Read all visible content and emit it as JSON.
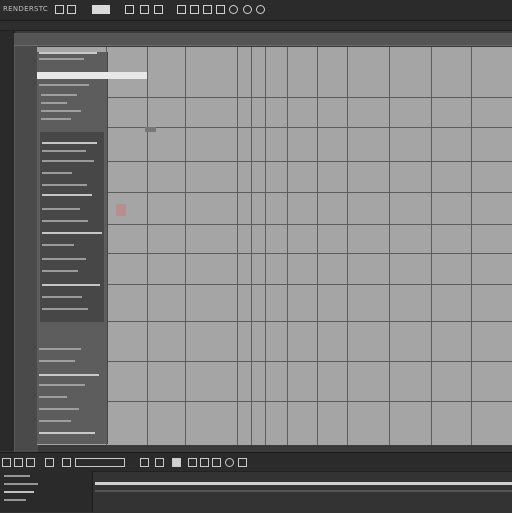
{
  "toolbar": {
    "label_1": "RENDER",
    "label_2": "STC",
    "icons": [
      "square-icon",
      "square-icon",
      "square-icon",
      "square-icon",
      "square-icon",
      "square-icon",
      "square-icon",
      "square-icon",
      "square-icon",
      "square-icon",
      "square-icon",
      "square-icon",
      "square-icon",
      "square-icon",
      "square-icon",
      "square-icon",
      "square-icon"
    ]
  },
  "properties": {
    "header": ""
  },
  "bottom_toolbar": {
    "icons": [
      "square-icon",
      "square-icon",
      "square-icon",
      "square-icon",
      "square-icon",
      "square-icon",
      "square-icon",
      "square-icon",
      "square-icon",
      "square-icon",
      "square-icon"
    ]
  },
  "colors": {
    "chrome_dark": "#2b2b2b",
    "canvas": "#a5a5a5",
    "grid_line": "#5d5d5d",
    "panel": "#5d5d5d",
    "highlight": "#e8e8e8"
  }
}
